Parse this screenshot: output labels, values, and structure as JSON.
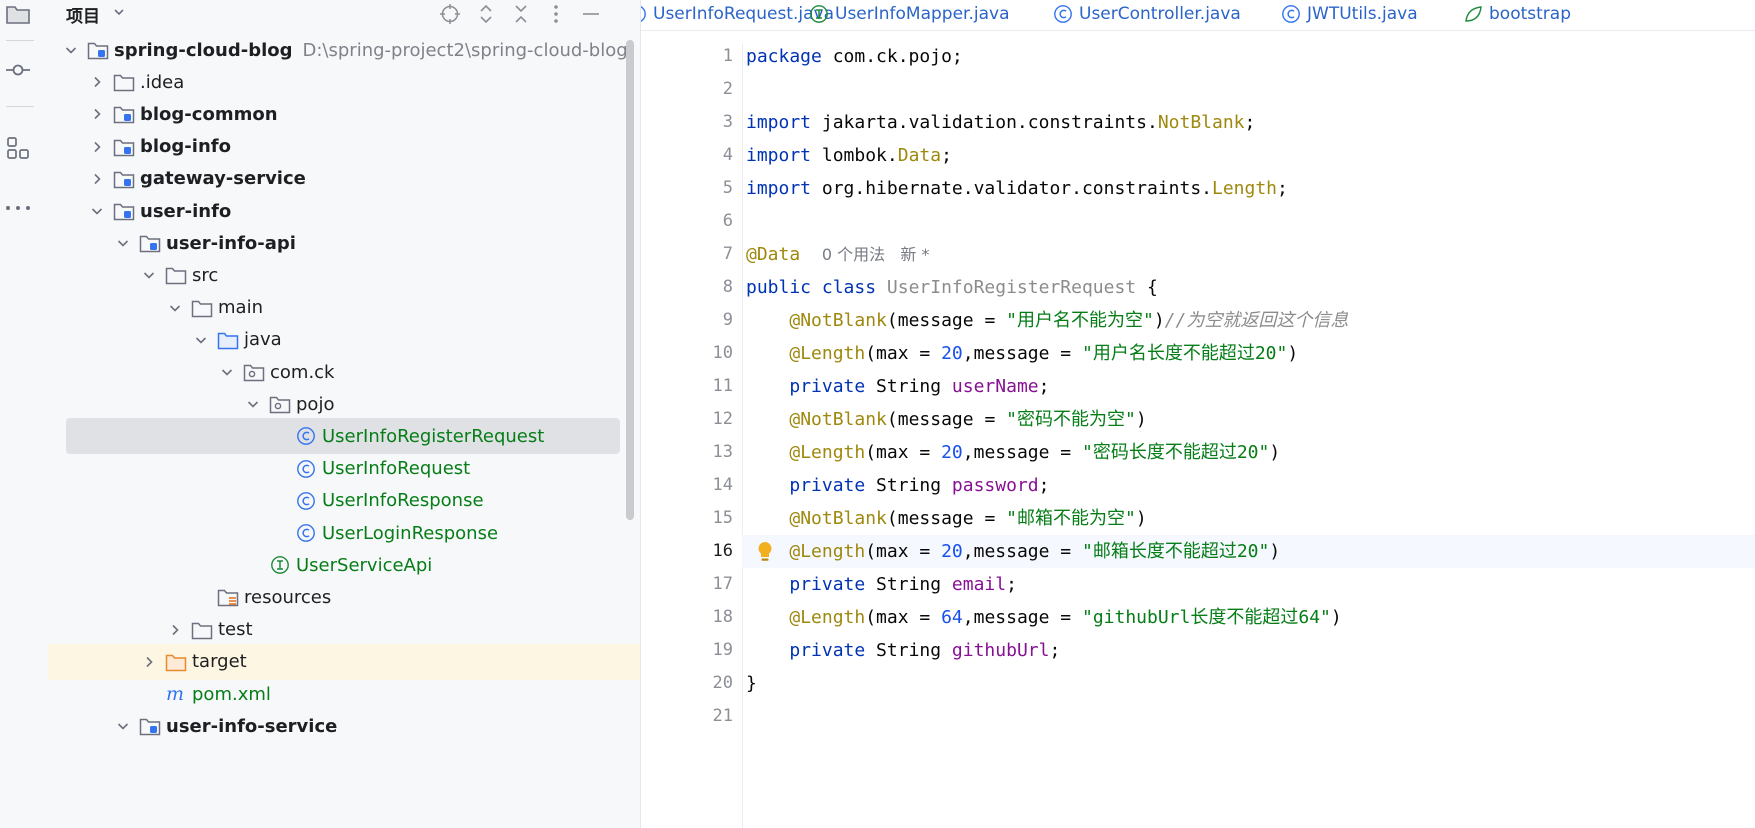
{
  "project_panel": {
    "title": "项目",
    "tree": [
      {
        "label": "spring-cloud-blog",
        "path": "D:\\spring-project2\\spring-cloud-blog",
        "depth": 0,
        "expanded": true,
        "icon": "module-folder",
        "bold": true
      },
      {
        "label": ".idea",
        "depth": 1,
        "expanded": false,
        "icon": "folder"
      },
      {
        "label": "blog-common",
        "depth": 1,
        "expanded": false,
        "icon": "module-folder",
        "bold": true
      },
      {
        "label": "blog-info",
        "depth": 1,
        "expanded": false,
        "icon": "module-folder",
        "bold": true
      },
      {
        "label": "gateway-service",
        "depth": 1,
        "expanded": false,
        "icon": "module-folder",
        "bold": true
      },
      {
        "label": "user-info",
        "depth": 1,
        "expanded": true,
        "icon": "module-folder",
        "bold": true
      },
      {
        "label": "user-info-api",
        "depth": 2,
        "expanded": true,
        "icon": "module-folder",
        "bold": true
      },
      {
        "label": "src",
        "depth": 3,
        "expanded": true,
        "icon": "folder"
      },
      {
        "label": "main",
        "depth": 4,
        "expanded": true,
        "icon": "folder"
      },
      {
        "label": "java",
        "depth": 5,
        "expanded": true,
        "icon": "source-folder"
      },
      {
        "label": "com.ck",
        "depth": 6,
        "expanded": true,
        "icon": "package"
      },
      {
        "label": "pojo",
        "depth": 7,
        "expanded": true,
        "icon": "package"
      },
      {
        "label": "UserInfoRegisterRequest",
        "depth": 8,
        "icon": "class",
        "selected": true,
        "green": true
      },
      {
        "label": "UserInfoRequest",
        "depth": 8,
        "icon": "class",
        "green": true
      },
      {
        "label": "UserInfoResponse",
        "depth": 8,
        "icon": "class",
        "green": true
      },
      {
        "label": "UserLoginResponse",
        "depth": 8,
        "icon": "class",
        "green": true
      },
      {
        "label": "UserServiceApi",
        "depth": 7,
        "icon": "interface",
        "green": true
      },
      {
        "label": "resources",
        "depth": 5,
        "icon": "resources-folder"
      },
      {
        "label": "test",
        "depth": 4,
        "expanded": false,
        "icon": "folder"
      },
      {
        "label": "target",
        "depth": 3,
        "expanded": false,
        "icon": "excluded-folder",
        "highlight": true
      },
      {
        "label": "pom.xml",
        "depth": 3,
        "icon": "maven",
        "green": true
      },
      {
        "label": "user-info-service",
        "depth": 2,
        "expanded": true,
        "icon": "module-folder",
        "bold": true
      }
    ]
  },
  "tabs": [
    {
      "label": "UserInfoRequest.java",
      "icon": "class-icon"
    },
    {
      "label": "UserInfoMapper.java",
      "icon": "interface-icon"
    },
    {
      "label": "UserController.java",
      "icon": "class-icon"
    },
    {
      "label": "JWTUtils.java",
      "icon": "class-icon"
    },
    {
      "label": "bootstrap",
      "icon": "spring-icon"
    }
  ],
  "editor": {
    "current_line": 16,
    "lines": [
      [
        [
          "kw",
          "package"
        ],
        [
          "p",
          " com.ck.pojo;"
        ]
      ],
      [],
      [
        [
          "kw",
          "import"
        ],
        [
          "p",
          " jakarta.validation.constraints."
        ],
        [
          "an",
          "NotBlank"
        ],
        [
          "p",
          ";"
        ]
      ],
      [
        [
          "kw",
          "import"
        ],
        [
          "p",
          " lombok."
        ],
        [
          "an",
          "Data"
        ],
        [
          "p",
          ";"
        ]
      ],
      [
        [
          "kw",
          "import"
        ],
        [
          "p",
          " org.hibernate.validator.constraints."
        ],
        [
          "an",
          "Length"
        ],
        [
          "p",
          ";"
        ]
      ],
      [],
      [
        [
          "an",
          "@Data"
        ],
        [
          "p",
          "  "
        ],
        [
          "hint",
          "0 个用法   新 *"
        ]
      ],
      [
        [
          "kw",
          "public class"
        ],
        [
          "p",
          " "
        ],
        [
          "ucls",
          "UserInfoRegisterRequest"
        ],
        [
          "p",
          " {"
        ]
      ],
      [
        [
          "p",
          "    "
        ],
        [
          "an",
          "@NotBlank"
        ],
        [
          "p",
          "(message = "
        ],
        [
          "str",
          "\"用户名不能为空\""
        ],
        [
          "p",
          ")"
        ],
        [
          "cmt",
          "//为空就返回这个信息"
        ]
      ],
      [
        [
          "p",
          "    "
        ],
        [
          "an",
          "@Length"
        ],
        [
          "p",
          "(max = "
        ],
        [
          "num",
          "20"
        ],
        [
          "p",
          ",message = "
        ],
        [
          "str",
          "\"用户名长度不能超过20\""
        ],
        [
          "p",
          ")"
        ]
      ],
      [
        [
          "p",
          "    "
        ],
        [
          "kw",
          "private"
        ],
        [
          "p",
          " String "
        ],
        [
          "fld",
          "userName"
        ],
        [
          "p",
          ";"
        ]
      ],
      [
        [
          "p",
          "    "
        ],
        [
          "an",
          "@NotBlank"
        ],
        [
          "p",
          "(message = "
        ],
        [
          "str",
          "\"密码不能为空\""
        ],
        [
          "p",
          ")"
        ]
      ],
      [
        [
          "p",
          "    "
        ],
        [
          "an",
          "@Length"
        ],
        [
          "p",
          "(max = "
        ],
        [
          "num",
          "20"
        ],
        [
          "p",
          ",message = "
        ],
        [
          "str",
          "\"密码长度不能超过20\""
        ],
        [
          "p",
          ")"
        ]
      ],
      [
        [
          "p",
          "    "
        ],
        [
          "kw",
          "private"
        ],
        [
          "p",
          " String "
        ],
        [
          "fld",
          "password"
        ],
        [
          "p",
          ";"
        ]
      ],
      [
        [
          "p",
          "    "
        ],
        [
          "an",
          "@NotBlank"
        ],
        [
          "p",
          "(message = "
        ],
        [
          "str",
          "\"邮箱不能为空\""
        ],
        [
          "p",
          ")"
        ]
      ],
      [
        [
          "p",
          "    "
        ],
        [
          "an",
          "@Length"
        ],
        [
          "p",
          "(max = "
        ],
        [
          "num",
          "20"
        ],
        [
          "p",
          ",message = "
        ],
        [
          "str",
          "\"邮箱长度不能超过20\""
        ],
        [
          "p",
          ")"
        ]
      ],
      [
        [
          "p",
          "    "
        ],
        [
          "kw",
          "private"
        ],
        [
          "p",
          " String "
        ],
        [
          "fld",
          "email"
        ],
        [
          "p",
          ";"
        ]
      ],
      [
        [
          "p",
          "    "
        ],
        [
          "an",
          "@Length"
        ],
        [
          "p",
          "(max = "
        ],
        [
          "num",
          "64"
        ],
        [
          "p",
          ",message = "
        ],
        [
          "str",
          "\"githubUrl长度不能超过64\""
        ],
        [
          "p",
          ")"
        ]
      ],
      [
        [
          "p",
          "    "
        ],
        [
          "kw",
          "private"
        ],
        [
          "p",
          " String "
        ],
        [
          "fld",
          "githubUrl"
        ],
        [
          "p",
          ";"
        ]
      ],
      [
        [
          "p",
          "}"
        ]
      ],
      []
    ]
  },
  "colors": {
    "keyword": "#0033b3",
    "annotation": "#9e880d",
    "string": "#067d17",
    "number": "#1750eb",
    "field": "#871094",
    "comment": "#8c8c8c",
    "selection": "#dfe1e5",
    "excluded_highlight": "#fdf6e3"
  }
}
